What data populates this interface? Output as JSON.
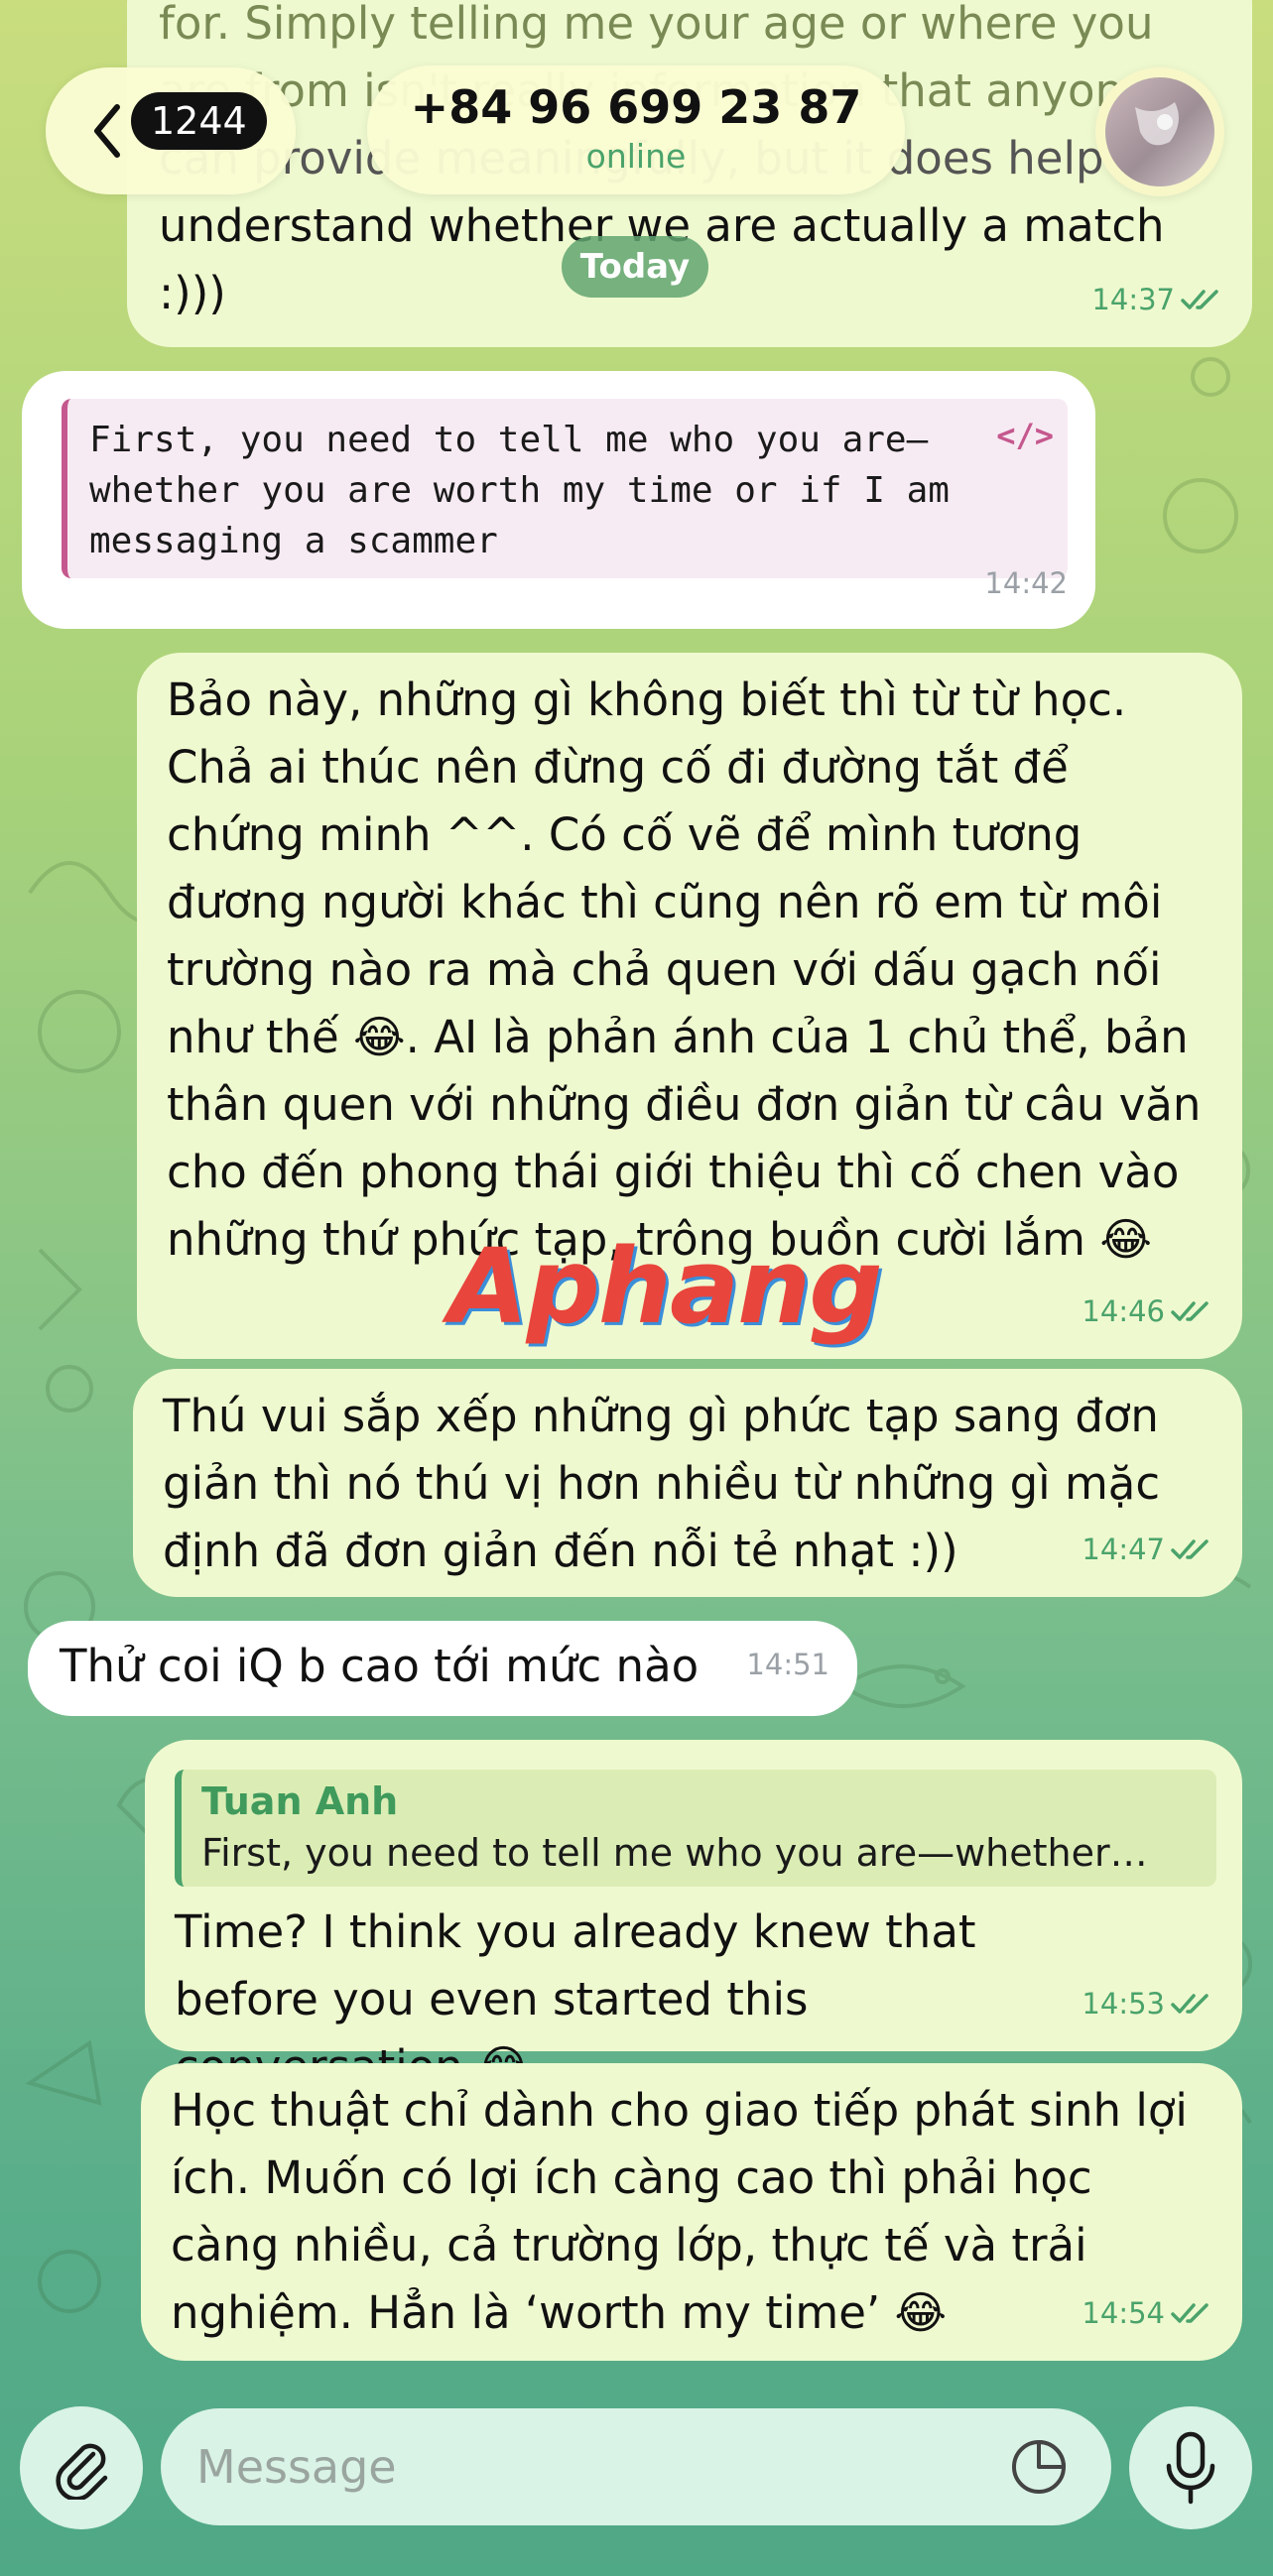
{
  "header": {
    "unread_count": "1244",
    "contact_name": "+84 96 699 23 87",
    "status": "online"
  },
  "date_separator": "Today",
  "messages": [
    {
      "direction": "out",
      "text_lines": [
        "for. Simply telling me your age or where you",
        "are from isn't really information that anyone",
        "can provide meaningfully, but it does help me",
        "understand whether we are actually a match",
        ":)))"
      ],
      "time": "14:37"
    },
    {
      "direction": "in",
      "code_lines": [
        "First, you need to tell me who you are—",
        "whether you are worth my time or if I am",
        "messaging a scammer"
      ],
      "time": "14:42"
    },
    {
      "direction": "out",
      "text": "Bảo này, những gì không biết thì từ từ học. Chả ai thúc nên đừng cố đi đường tắt để chứng minh ^^. Có cố vẽ để mình tương đương người khác thì cũng nên rõ em từ môi trường nào ra mà chả quen với dấu gạch nối như thế 😂. AI là phản ánh của 1 chủ thể, bản thân quen với những điều đơn giản từ câu văn cho đến phong thái giới thiệu thì cố chen vào những thứ phức tạp, trông buồn cười lắm 😂",
      "time": "14:46"
    },
    {
      "direction": "out",
      "text": "Thú vui sắp xếp những gì phức tạp sang đơn giản thì nó thú vị hơn nhiều từ những gì mặc định đã đơn giản đến nỗi tẻ nhạt :))",
      "time": "14:47"
    },
    {
      "direction": "in",
      "text": "Thử coi iQ b cao tới mức nào",
      "time": "14:51"
    },
    {
      "direction": "out",
      "reply_to": {
        "name": "Tuan Anh",
        "text": "First, you need to tell me who you are—whether…"
      },
      "text": "Time? I think you already knew that before you even started this conversation 😂",
      "time": "14:53"
    },
    {
      "direction": "out",
      "text": "Học thuật chỉ dành cho giao tiếp phát sinh lợi ích. Muốn có lợi ích càng cao thì phải học càng nhiều, cả trường lớp, thực tế và trải nghiệm. Hẳn là ‘worth my time’ 😂",
      "time": "14:54"
    }
  ],
  "watermark": "Aphang",
  "composer": {
    "placeholder": "Message"
  },
  "icons": {
    "back": "chevron-left-icon",
    "attach": "paperclip-icon",
    "sticker": "sticker-icon",
    "mic": "microphone-icon",
    "read": "double-check-icon"
  },
  "colors": {
    "outgoing_bubble": "#eff9cf",
    "incoming_bubble": "#ffffff",
    "accent_green": "#4aa36b",
    "code_accent": "#c5588e"
  }
}
